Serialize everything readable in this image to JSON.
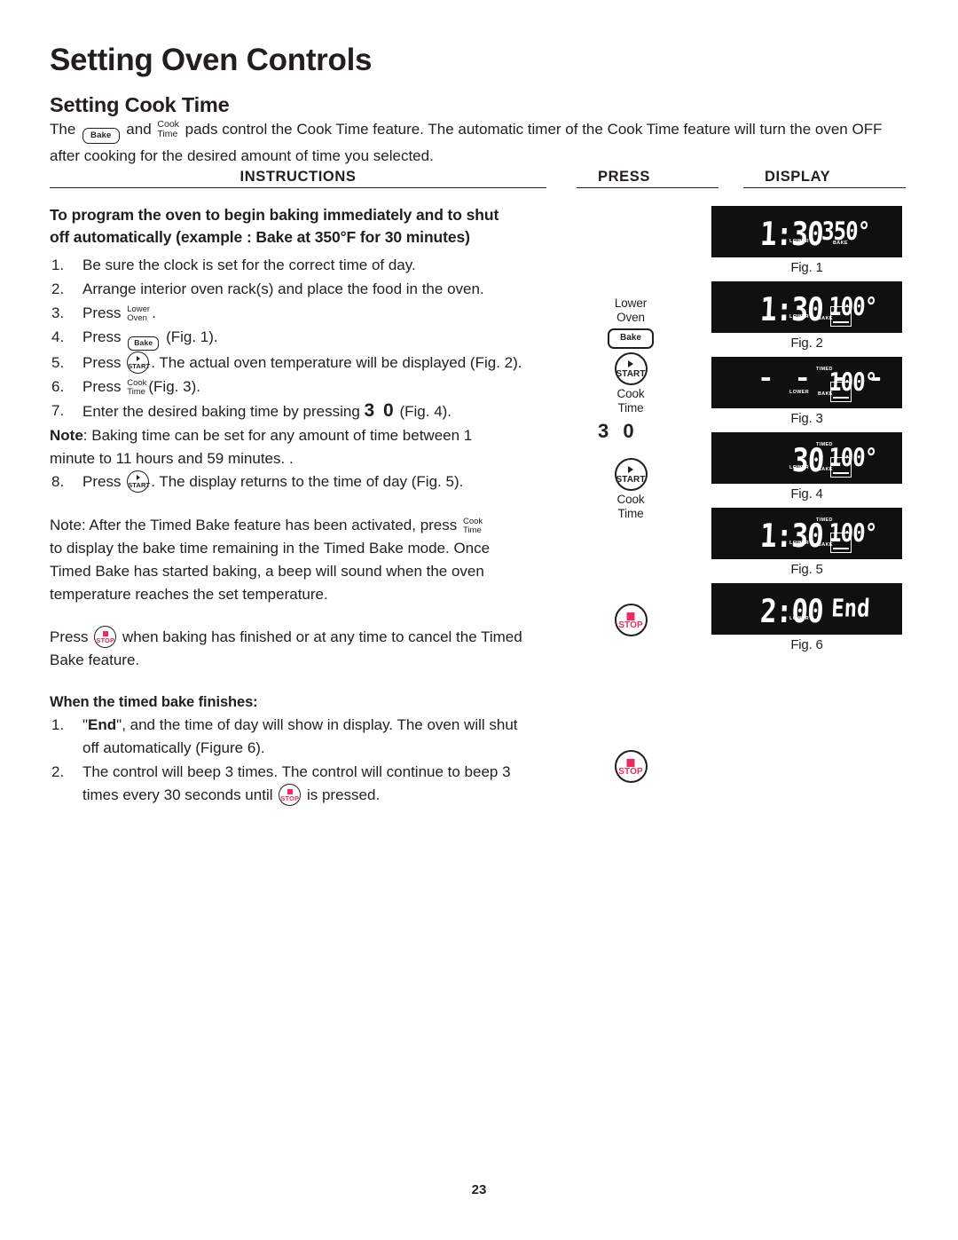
{
  "document": {
    "title": "Setting Oven Controls",
    "section_title": "Setting Cook Time",
    "page_number": "23"
  },
  "intro": {
    "before_bake": "The",
    "bake_pad": "Bake",
    "between": "and",
    "cook_pad_line1": "Cook",
    "cook_pad_line2": "Time",
    "after": "pads control the Cook Time feature. The automatic timer of the Cook Time feature will turn the oven OFF",
    "line2": "after cooking for the desired amount of time you selected."
  },
  "columns": {
    "instructions": "INSTRUCTIONS",
    "press": "PRESS",
    "display": "DISPLAY"
  },
  "instructions": {
    "heading_line1": "To program the oven to begin baking immediately and to shut",
    "heading_line2": "off automatically (example : Bake at 350°F for 30 minutes)",
    "steps": [
      {
        "num": "1.",
        "text": "Be sure the clock is set for the correct time of day."
      },
      {
        "num": "2.",
        "text": "Arrange interior oven rack(s) and place the food in the oven."
      },
      {
        "num": "3.",
        "pre": "Press",
        "pad": "Lower/Oven",
        "post": "."
      },
      {
        "num": "4.",
        "pre": "Press",
        "pad": "Bake",
        "post": "(Fig. 1)."
      },
      {
        "num": "5.",
        "pre": "Press",
        "pad": "START",
        "post": ". The actual oven temperature will be displayed (Fig. 2)."
      },
      {
        "num": "6.",
        "pre": "Press",
        "pad": "Cook/Time",
        "post": "(Fig. 3)."
      },
      {
        "num": "7.",
        "pre": "Enter the desired baking time by pressing",
        "pad": "3 0",
        "post": "(Fig. 4)."
      }
    ],
    "note1_bold": "Note",
    "note1_text": ": Baking time can be set for any amount of time between 1",
    "note1_line2": "minute to 11 hours and 59 minutes.  .",
    "step8": {
      "num": "8.",
      "pre": "Press",
      "pad": "START",
      "post": ". The display returns to the time of day (Fig. 5)."
    },
    "note2_line1": "Note: After the Timed Bake feature has been activated, press",
    "note2_pad_line1": "Cook",
    "note2_pad_line2": "Time",
    "note2_line2": "to display the bake time remaining in the Timed Bake mode. Once",
    "note2_line3": "Timed Bake has started baking, a beep will sound when the oven",
    "note2_line4": "temperature reaches the set temperature.",
    "stop_para_pre": "Press",
    "stop_para_post": "when baking has finished or at any time to cancel the Timed",
    "stop_para_line2": "Bake feature.",
    "finish_heading": "When the timed bake finishes:",
    "finish_1_num": "1.",
    "finish_1_a": "\"",
    "finish_1_bold": "End",
    "finish_1_b": "\", and the time of day will show in display. The oven will shut",
    "finish_1_line2": "off automatically (Figure 6).",
    "finish_2_num": "2.",
    "finish_2_line1": "The control will beep 3 times. The control will continue to beep 3",
    "finish_2_pre": "times every 30 seconds until",
    "finish_2_post": "is pressed."
  },
  "press_column": {
    "lower_oven_l1": "Lower",
    "lower_oven_l2": "Oven",
    "bake_label": "Bake",
    "start_label": "START",
    "cook_time_l1": "Cook",
    "cook_time_l2": "Time",
    "digits": "3 0",
    "start_label_2": "START",
    "cook_time2_l1": "Cook",
    "cook_time2_l2": "Time",
    "stop_label": "STOP",
    "stop_label_2": "STOP"
  },
  "figures": [
    {
      "caption": "Fig. 1",
      "time": "1:30",
      "temp": "350°",
      "dashes": null,
      "end": null,
      "indicators": {
        "lower": "LOWER",
        "timed": null,
        "bake": "BAKE"
      },
      "oven_icon": false
    },
    {
      "caption": "Fig. 2",
      "time": "1:30",
      "temp": "100°",
      "dashes": null,
      "end": null,
      "indicators": {
        "lower": "LOWER",
        "timed": null,
        "bake": "BAKE"
      },
      "oven_icon": true
    },
    {
      "caption": "Fig. 3",
      "time": null,
      "temp": "100°",
      "dashes": "- - - -",
      "end": null,
      "indicators": {
        "lower": "LOWER",
        "timed": "TIMED",
        "bake": "BAKE"
      },
      "oven_icon": true
    },
    {
      "caption": "Fig. 4",
      "time": "30",
      "temp": "100°",
      "dashes": null,
      "end": null,
      "indicators": {
        "lower": "LOWER",
        "timed": "TIMED",
        "bake": "BAKE"
      },
      "oven_icon": true
    },
    {
      "caption": "Fig. 5",
      "time": "1:30",
      "temp": "100°",
      "dashes": null,
      "end": null,
      "indicators": {
        "lower": "LOWER",
        "timed": "TIMED",
        "bake": "BAKE"
      },
      "oven_icon": true
    },
    {
      "caption": "Fig. 6",
      "time": "2:00",
      "temp": null,
      "dashes": null,
      "end": "End",
      "indicators": {
        "lower": "LOWER",
        "timed": null,
        "bake": null
      },
      "oven_icon": false
    }
  ],
  "colors": {
    "text": "#221e1f",
    "stop_accent": "#ee2b5e",
    "lcd_background": "#111010",
    "lcd_segment": "#ffffff"
  }
}
